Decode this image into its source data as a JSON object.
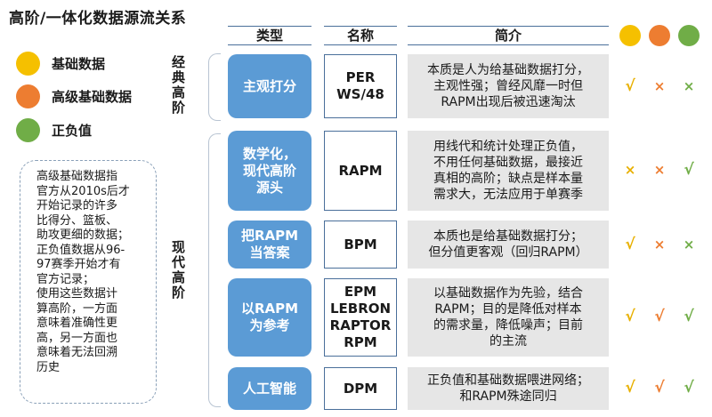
{
  "title": "高阶/一体化数据源流关系",
  "colors": {
    "yellow": "#f5c000",
    "orange": "#ed7d31",
    "green": "#70ad47",
    "type_box": "#5b9bd5",
    "desc_bg": "#e6e6e6"
  },
  "legend": [
    {
      "label": "基础数据",
      "color": "#f5c000"
    },
    {
      "label": "高级基础数据",
      "color": "#ed7d31"
    },
    {
      "label": "正负值",
      "color": "#70ad47"
    }
  ],
  "note": "高级基础数据指\n官方从2010s后才\n开始记录的许多\n比得分、篮板、\n助攻更细的数据；\n正负值数据从96-\n97赛季开始才有\n官方记录；\n使用这些数据计\n算高阶，一方面\n意味着准确性更\n高，另一方面也\n意味着无法回溯\n历史",
  "sections": {
    "classic": "经典高阶",
    "modern": "现代高阶"
  },
  "headers": {
    "type": "类型",
    "name": "名称",
    "desc": "简介"
  },
  "rows": [
    {
      "type": "主观打分",
      "name": "PER\nWS/48",
      "desc": "本质是人为给基础数据打分，\n主观性强；曾经风靡一时但\nRAPM出现后被迅速淘汰",
      "marks": [
        {
          "symbol": "√",
          "color": "#e8b000"
        },
        {
          "symbol": "×",
          "color": "#ed7d31"
        },
        {
          "symbol": "×",
          "color": "#70ad47"
        }
      ]
    },
    {
      "type": "数学化，\n现代高阶\n源头",
      "name": "RAPM",
      "desc": "用线代和统计处理正负值，\n不用任何基础数据，最接近\n真相的高阶；缺点是样本量\n需求大，无法应用于单赛季",
      "marks": [
        {
          "symbol": "×",
          "color": "#e8b000"
        },
        {
          "symbol": "×",
          "color": "#ed7d31"
        },
        {
          "symbol": "√",
          "color": "#70ad47"
        }
      ]
    },
    {
      "type": "把RAPM\n当答案",
      "name": "BPM",
      "desc": "本质也是给基础数据打分；\n但分值更客观（回归RAPM）",
      "marks": [
        {
          "symbol": "√",
          "color": "#e8b000"
        },
        {
          "symbol": "×",
          "color": "#ed7d31"
        },
        {
          "symbol": "×",
          "color": "#70ad47"
        }
      ]
    },
    {
      "type": "以RAPM\n为参考",
      "name": "EPM\nLEBRON\nRAPTOR\nRPM",
      "desc": "以基础数据作为先验，结合\nRAPM；目的是降低对样本\n的需求量，降低噪声；目前\n的主流",
      "marks": [
        {
          "symbol": "√",
          "color": "#e8b000"
        },
        {
          "symbol": "√",
          "color": "#ed7d31"
        },
        {
          "symbol": "√",
          "color": "#70ad47"
        }
      ]
    },
    {
      "type": "人工智能",
      "name": "DPM",
      "desc": "正负值和基础数据喂进网络；\n和RAPM殊途同归",
      "marks": [
        {
          "symbol": "√",
          "color": "#e8b000"
        },
        {
          "symbol": "√",
          "color": "#ed7d31"
        },
        {
          "symbol": "√",
          "color": "#70ad47"
        }
      ]
    }
  ]
}
